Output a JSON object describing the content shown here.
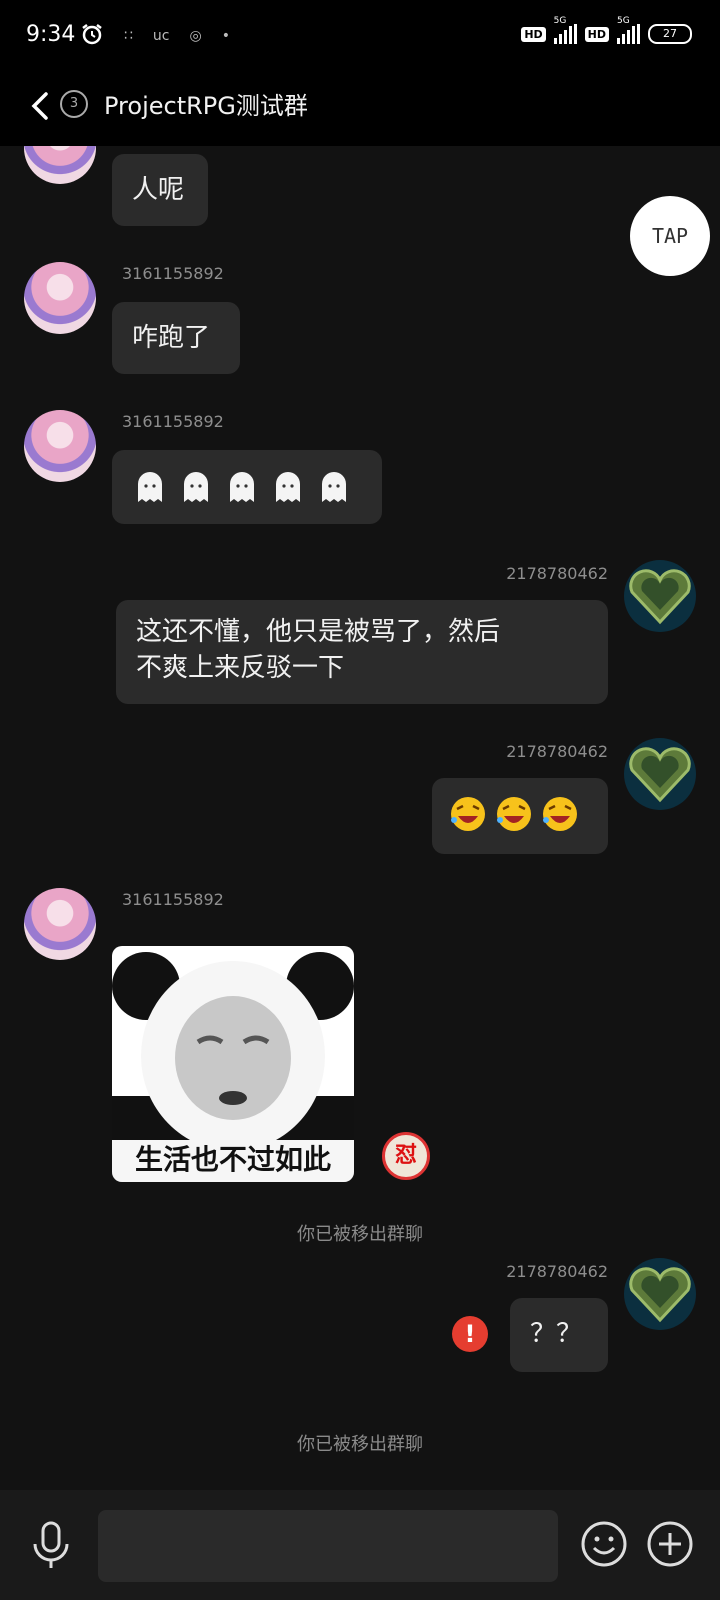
{
  "status_bar": {
    "time": "9:34",
    "left_icons": [
      "alarm-icon",
      "app-icon",
      "uc-icon",
      "app-icon",
      "dot-icon"
    ],
    "hd1": "HD",
    "net1": "5G",
    "hd2": "HD",
    "net2": "5G",
    "battery": "27"
  },
  "header": {
    "unread_count": "3",
    "title": "ProjectRPG测试群"
  },
  "floating": {
    "tap_label": "TAP"
  },
  "messages": [
    {
      "side": "left",
      "sender": "",
      "text": "人呢"
    },
    {
      "side": "left",
      "sender": "3161155892",
      "text": "咋跑了"
    },
    {
      "side": "left",
      "sender": "3161155892",
      "emoji": "ghost-emoji",
      "emoji_count": 5
    },
    {
      "side": "right",
      "sender": "2178780462",
      "line1": "这还不懂，他只是被骂了，然后",
      "line2": "不爽上来反驳一下"
    },
    {
      "side": "right",
      "sender": "2178780462",
      "emoji": "laugh-cry-emoji",
      "emoji_count": 3
    },
    {
      "side": "left",
      "sender": "3161155892",
      "sticker_caption": "生活也不过如此",
      "reaction": "怼"
    },
    {
      "side": "right",
      "sender": "2178780462",
      "text": "？？"
    }
  ],
  "system": {
    "removed1": "你已被移出群聊",
    "removed2": "你已被移出群聊"
  },
  "input_bar": {
    "placeholder": "",
    "value": ""
  },
  "colors": {
    "background": "#121212",
    "bubble": "#2b2b2b",
    "error": "#e53d30",
    "bar": "#000000"
  }
}
